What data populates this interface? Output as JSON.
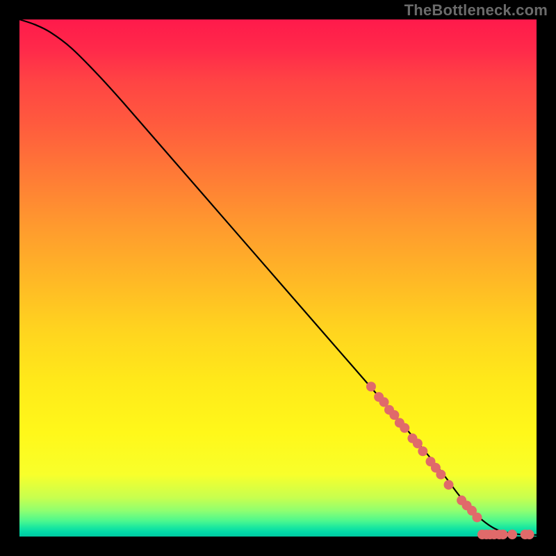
{
  "watermark": "TheBottleneck.com",
  "chart_data": {
    "type": "line",
    "title": "",
    "xlabel": "",
    "ylabel": "",
    "xlim": [
      0,
      100
    ],
    "ylim": [
      0,
      100
    ],
    "grid": false,
    "series": [
      {
        "name": "curve",
        "x": [
          0,
          3,
          6,
          10,
          15,
          20,
          30,
          40,
          50,
          60,
          70,
          78,
          82,
          85,
          88,
          92,
          96,
          100
        ],
        "y": [
          100,
          99,
          97.5,
          94.5,
          89.5,
          84,
          72.5,
          61,
          49.5,
          38,
          26.5,
          17,
          12,
          8,
          4.5,
          1.5,
          0.5,
          0.3
        ]
      }
    ],
    "markers": [
      {
        "name": "dots-on-curve",
        "color": "#e06a6a",
        "radius_px": 7,
        "points": [
          {
            "x": 68.0,
            "y": 29.0
          },
          {
            "x": 69.5,
            "y": 27.0
          },
          {
            "x": 70.5,
            "y": 26.0
          },
          {
            "x": 71.5,
            "y": 24.5
          },
          {
            "x": 72.5,
            "y": 23.5
          },
          {
            "x": 73.5,
            "y": 22.0
          },
          {
            "x": 74.5,
            "y": 21.0
          },
          {
            "x": 76.0,
            "y": 19.0
          },
          {
            "x": 77.0,
            "y": 18.0
          },
          {
            "x": 78.0,
            "y": 16.5
          },
          {
            "x": 79.5,
            "y": 14.5
          },
          {
            "x": 80.5,
            "y": 13.3
          },
          {
            "x": 81.5,
            "y": 12.0
          },
          {
            "x": 83.0,
            "y": 10.0
          },
          {
            "x": 85.5,
            "y": 7.0
          },
          {
            "x": 86.5,
            "y": 6.0
          },
          {
            "x": 87.5,
            "y": 5.0
          },
          {
            "x": 88.5,
            "y": 3.7
          }
        ]
      },
      {
        "name": "dots-baseline",
        "color": "#e06a6a",
        "radius_px": 7,
        "points": [
          {
            "x": 89.5,
            "y": 0.4
          },
          {
            "x": 90.3,
            "y": 0.4
          },
          {
            "x": 91.0,
            "y": 0.4
          },
          {
            "x": 91.8,
            "y": 0.4
          },
          {
            "x": 92.8,
            "y": 0.4
          },
          {
            "x": 93.5,
            "y": 0.4
          },
          {
            "x": 95.3,
            "y": 0.4
          },
          {
            "x": 97.8,
            "y": 0.4
          },
          {
            "x": 98.6,
            "y": 0.4
          }
        ]
      }
    ],
    "gradient_stops": [
      {
        "pos": 0.0,
        "color": "#ff1a4b"
      },
      {
        "pos": 0.5,
        "color": "#ffb726"
      },
      {
        "pos": 0.88,
        "color": "#f8ff2b"
      },
      {
        "pos": 0.97,
        "color": "#4cf88f"
      },
      {
        "pos": 1.0,
        "color": "#00c8a0"
      }
    ]
  }
}
